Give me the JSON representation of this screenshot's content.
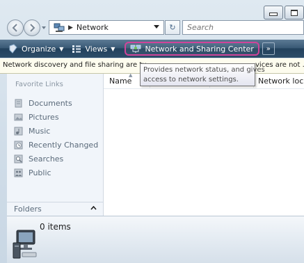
{
  "window": {
    "caption_buttons": [
      "minimize",
      "maximize"
    ]
  },
  "address": {
    "crumb": "Network",
    "refresh_glyph": "↻",
    "search_placeholder": "Search"
  },
  "command_bar": {
    "organize": "Organize",
    "views": "Views",
    "network_and_sharing": "Network and Sharing Center",
    "more": "»"
  },
  "info_bar": {
    "left_text": "Network discovery and file sharing are tu",
    "right_text": "vices are not ..."
  },
  "tooltip": {
    "line1": "Provides network status, and gives",
    "line2": "access to network settings."
  },
  "nav_pane": {
    "title": "Favorite Links",
    "items": [
      {
        "label": "Documents",
        "icon": "documents-icon"
      },
      {
        "label": "Pictures",
        "icon": "pictures-icon"
      },
      {
        "label": "Music",
        "icon": "music-icon"
      },
      {
        "label": "Recently Changed",
        "icon": "recently-changed-icon"
      },
      {
        "label": "Searches",
        "icon": "searches-icon"
      },
      {
        "label": "Public",
        "icon": "public-icon"
      }
    ],
    "folders_label": "Folders"
  },
  "columns": {
    "name": "Name",
    "network_location": "Network locat"
  },
  "details": {
    "count": "0 items"
  },
  "colors": {
    "command_bar": "#2d4d69",
    "highlight_ring": "#d0449a",
    "info_bar": "#fdfcee",
    "nav_pane": "#f1f5fa"
  }
}
